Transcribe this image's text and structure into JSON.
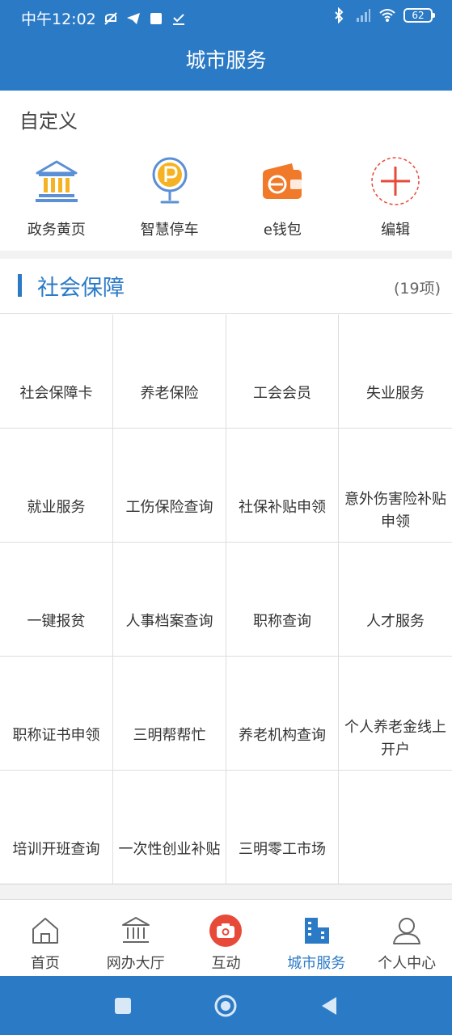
{
  "status_bar": {
    "time": "中午12:02",
    "battery": "62"
  },
  "header": {
    "title": "城市服务"
  },
  "custom": {
    "title": "自定义",
    "items": [
      {
        "label": "政务黄页",
        "icon": "bank-icon"
      },
      {
        "label": "智慧停车",
        "icon": "parking-icon"
      },
      {
        "label": "e钱包",
        "icon": "wallet-icon"
      },
      {
        "label": "编辑",
        "icon": "add-icon"
      }
    ]
  },
  "social": {
    "title": "社会保障",
    "count": "(19项)",
    "items": [
      "社会保障卡",
      "养老保险",
      "工会会员",
      "失业服务",
      "就业服务",
      "工伤保险查询",
      "社保补贴申领",
      "意外伤害险补贴申领",
      "一键报贫",
      "人事档案查询",
      "职称查询",
      "人才服务",
      "职称证书申领",
      "三明帮帮忙",
      "养老机构查询",
      "个人养老金线上开户",
      "培训开班查询",
      "一次性创业补贴",
      "三明零工市场",
      ""
    ]
  },
  "bottom_nav": {
    "items": [
      {
        "label": "首页",
        "icon": "home-icon"
      },
      {
        "label": "网办大厅",
        "icon": "hall-icon"
      },
      {
        "label": "互动",
        "icon": "camera-icon"
      },
      {
        "label": "城市服务",
        "icon": "city-icon",
        "active": true
      },
      {
        "label": "个人中心",
        "icon": "user-icon"
      }
    ]
  },
  "colors": {
    "primary": "#2b7ac6",
    "accent_red": "#e84a3a",
    "accent_orange": "#f07a2a",
    "gold": "#f5b323"
  }
}
